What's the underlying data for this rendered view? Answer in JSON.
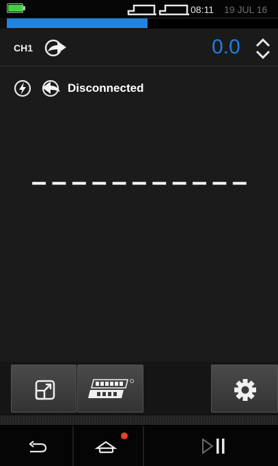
{
  "status_bar": {
    "battery_level": 0.95,
    "time": "08:11",
    "date": "19 JUL 16",
    "battery_color": "#3fd43f",
    "icons": [
      "battery-icon",
      "usb-icon",
      "usb-icon"
    ]
  },
  "progress": {
    "value": 0.52,
    "color": "#1e84e0"
  },
  "channel": {
    "label": "CH1",
    "value": "0.0",
    "value_color": "#1c7fe0",
    "icons": [
      "output-arrow-icon",
      "up-down-chevron-icon"
    ]
  },
  "main": {
    "status_text": "Disconnected",
    "reading": "– – – – – – – – – – –",
    "icons": [
      "power-bolt-icon",
      "input-arrow-icon"
    ]
  },
  "softkeys": {
    "icons": [
      "expand-icon",
      "profibus-logo",
      "gear-icon"
    ],
    "profibus_logo_text": "PROFI BUS"
  },
  "navbar": {
    "icons": [
      "back-icon",
      "home-icon",
      "play-pause-icon"
    ],
    "home_indicator_color": "#e8412c"
  }
}
